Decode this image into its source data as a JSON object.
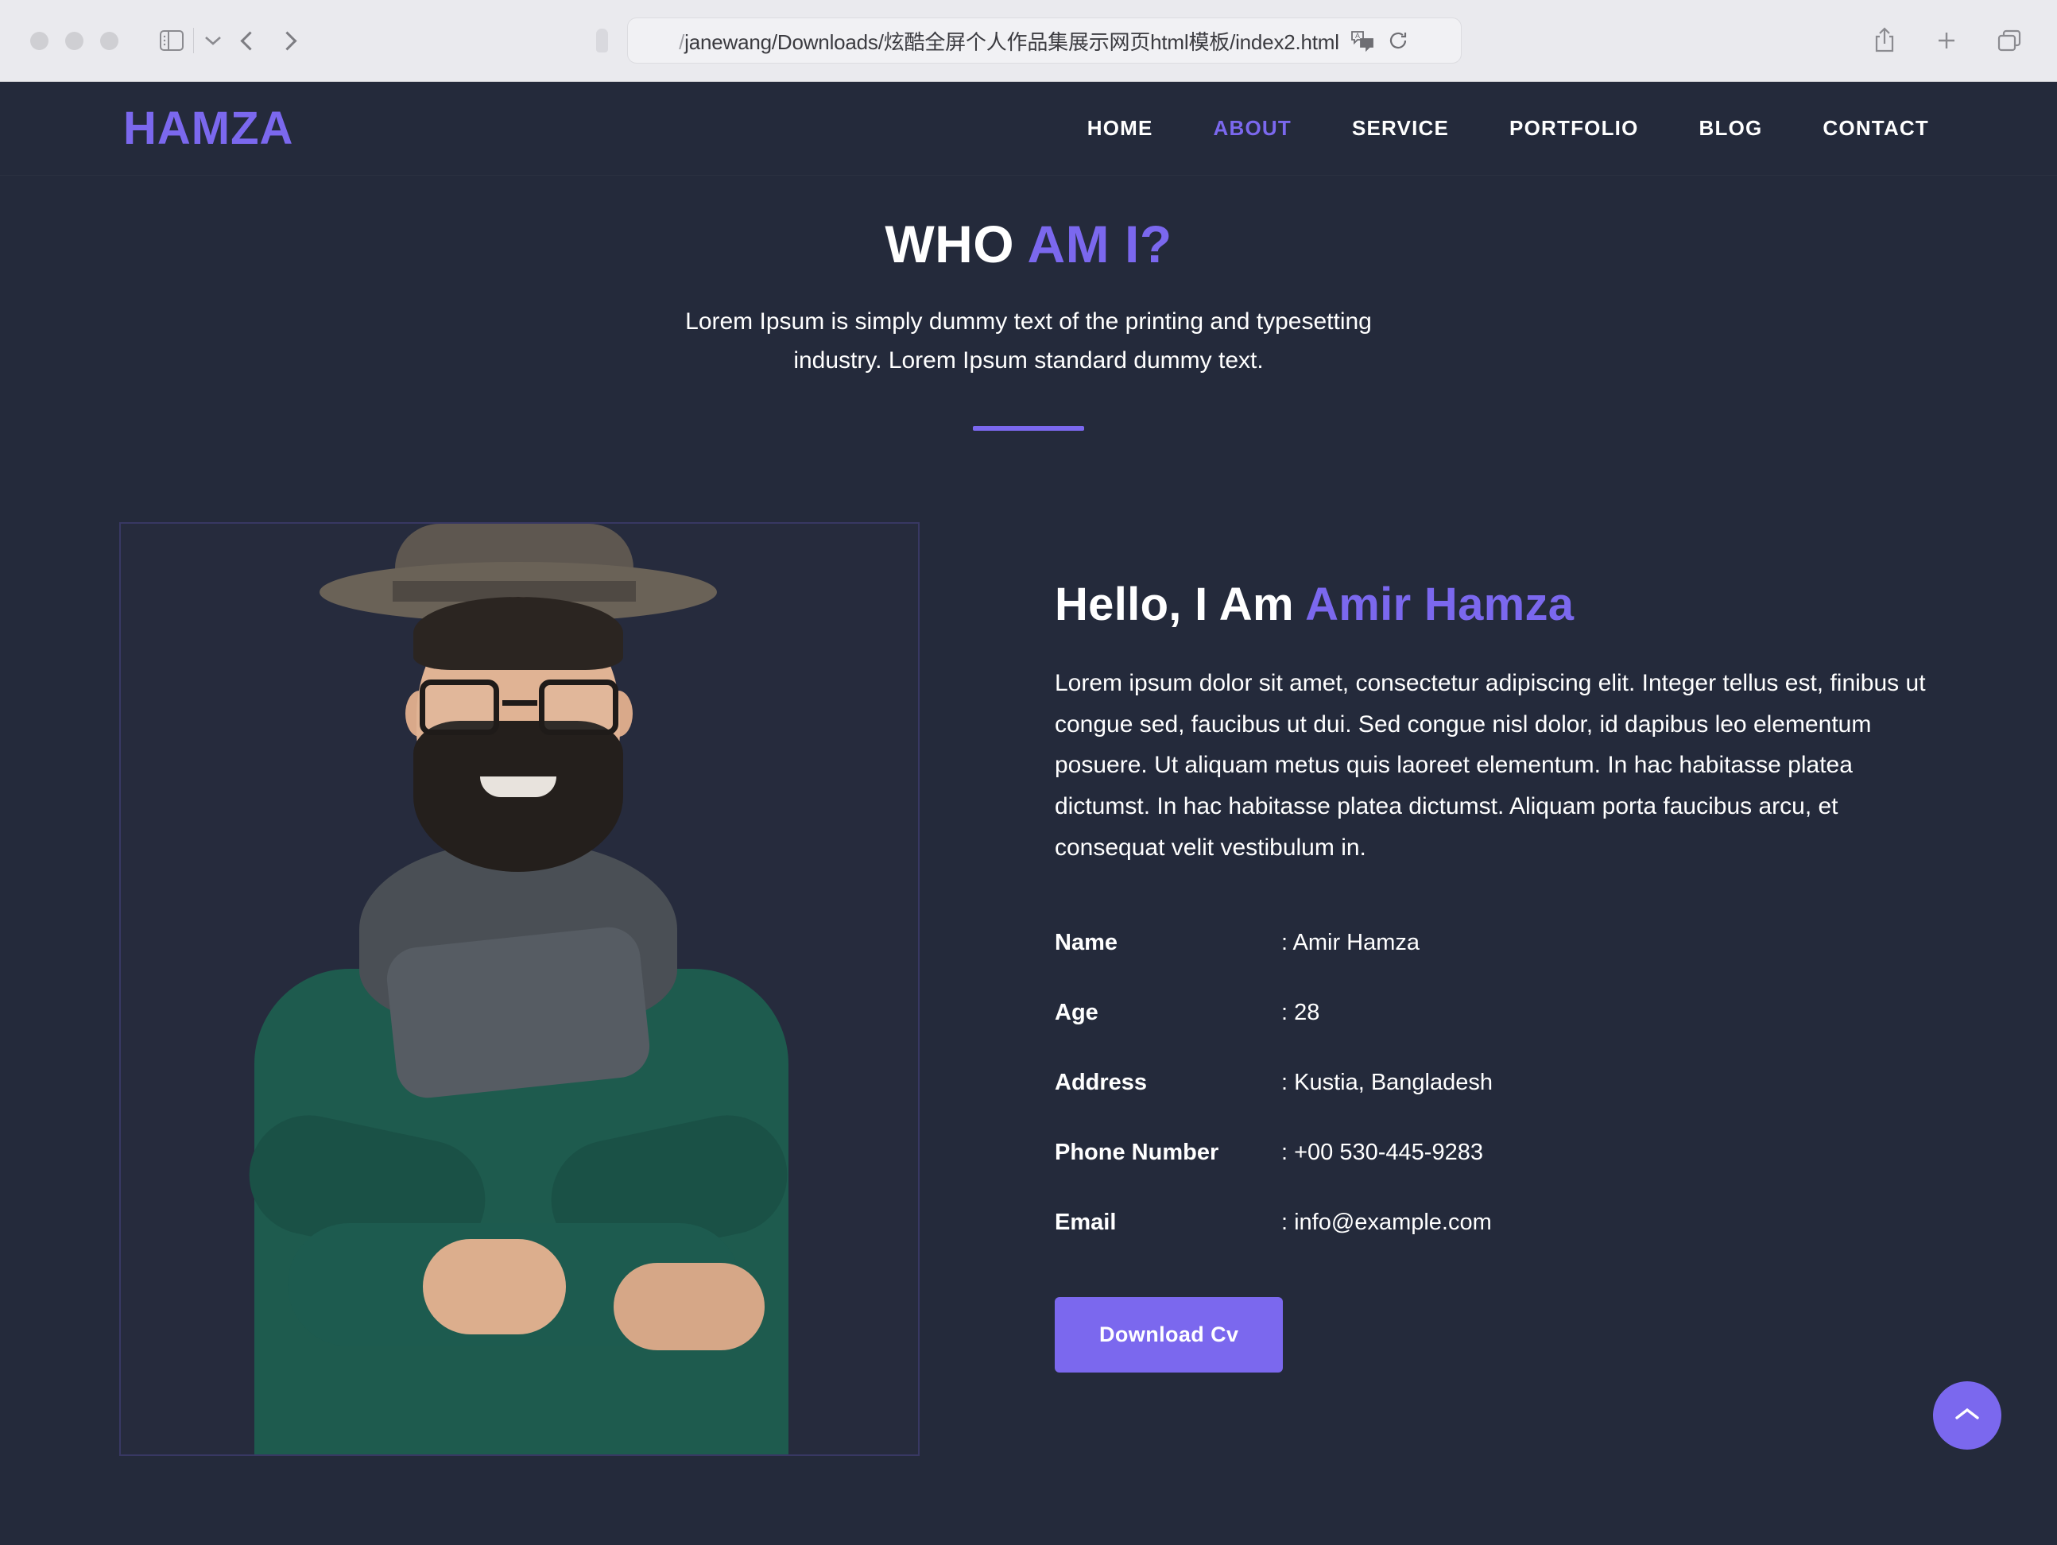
{
  "browser": {
    "url_prefix": "/",
    "url_text": "janewang/Downloads/炫酷全屏个人作品集展示网页html模板/index2.html",
    "icons": {
      "sidebar": "sidebar-icon",
      "sidebar_chevron": "chevron-down-icon",
      "back": "back-arrow-icon",
      "forward": "forward-arrow-icon",
      "shield": "shield-icon",
      "translate": "translate-icon",
      "reload": "reload-icon",
      "share": "share-icon",
      "new_tab": "plus-icon",
      "tab_overview": "tab-overview-icon"
    }
  },
  "site": {
    "logo": "HAMZA",
    "nav": [
      {
        "label": "HOME",
        "active": false
      },
      {
        "label": "ABOUT",
        "active": true
      },
      {
        "label": "SERVICE",
        "active": false
      },
      {
        "label": "PORTFOLIO",
        "active": false
      },
      {
        "label": "BLOG",
        "active": false
      },
      {
        "label": "CONTACT",
        "active": false
      }
    ]
  },
  "section": {
    "title_plain": "WHO ",
    "title_accent": "AM I?",
    "subtitle_line1": "Lorem Ipsum is simply dummy text of the printing and typesetting",
    "subtitle_line2": "industry. Lorem Ipsum standard dummy text."
  },
  "about": {
    "photo_alt": "portrait-photo",
    "heading_plain": "Hello, I Am ",
    "heading_accent": "Amir Hamza",
    "paragraph": "Lorem ipsum dolor sit amet, consectetur adipiscing elit. Integer tellus est, finibus ut congue sed, faucibus ut dui. Sed congue nisl dolor, id dapibus leo elementum posuere. Ut aliquam metus quis laoreet elementum. In hac habitasse platea dictumst. In hac habitasse platea dictumst. Aliquam porta faucibus arcu, et consequat velit vestibulum in.",
    "info": [
      {
        "label": "Name",
        "value": ": Amir Hamza"
      },
      {
        "label": "Age",
        "value": ": 28"
      },
      {
        "label": "Address",
        "value": ": Kustia, Bangladesh"
      },
      {
        "label": "Phone Number",
        "value": ": +00 530-445-9283"
      },
      {
        "label": "Email",
        "value": ": info@example.com"
      }
    ],
    "cv_button": "Download Cv"
  },
  "colors": {
    "page_bg": "#242a3b",
    "accent": "#7b68ee",
    "text": "#ffffff",
    "chrome_bg": "#eaeaee"
  },
  "scroll_top": {
    "icon": "chevron-up-icon"
  }
}
